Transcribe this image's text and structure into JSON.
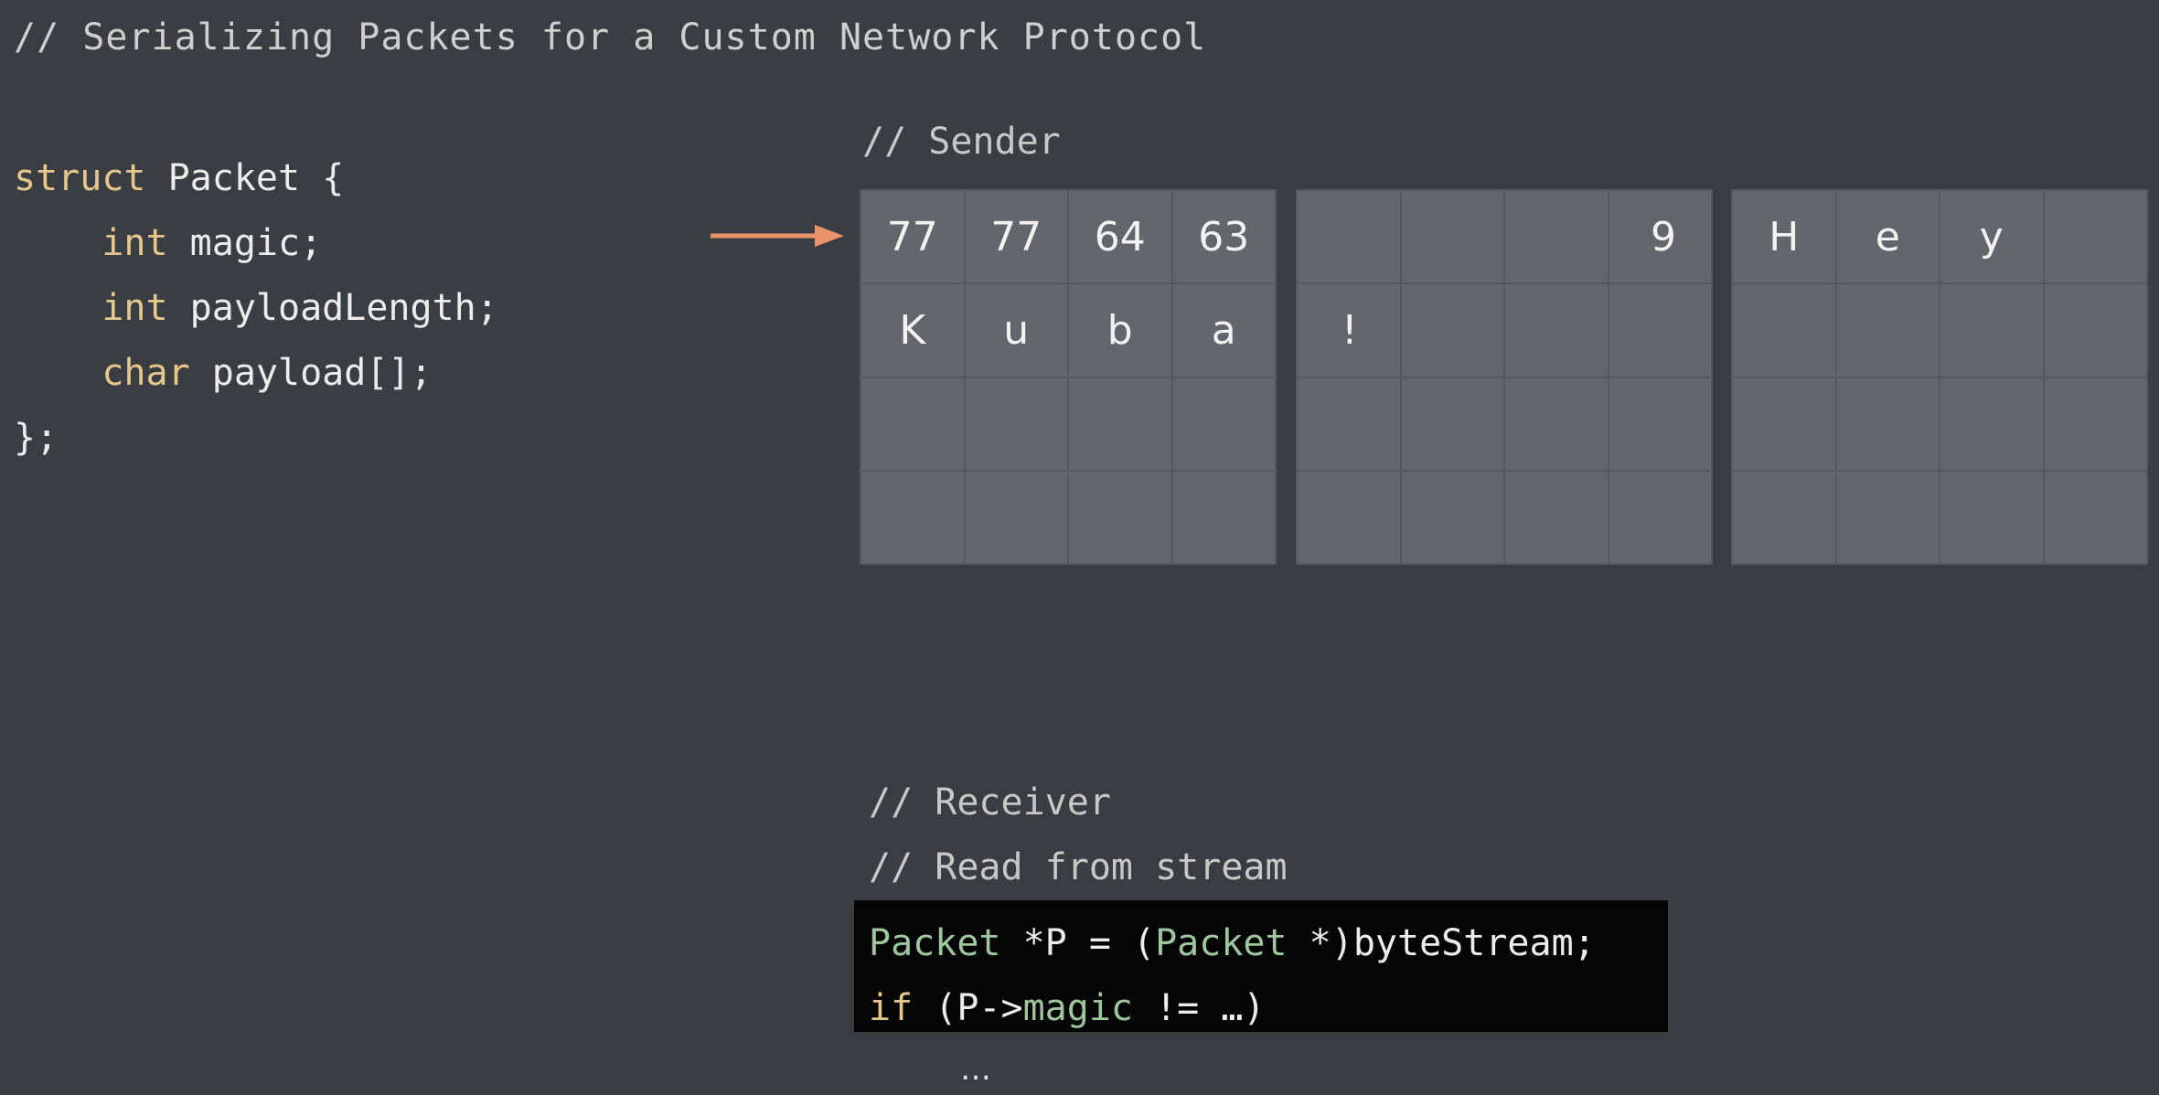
{
  "title": "// Serializing Packets for a Custom Network Protocol",
  "struct_code": {
    "line1_kw": "struct",
    "line1_rest": " Packet {",
    "line2_kw": "int",
    "line2_rest": " magic;",
    "line3_kw": "int",
    "line3_rest": " payloadLength;",
    "line4_kw": "char",
    "line4_rest": " payload[];",
    "line5": "};"
  },
  "sender": {
    "comment": "// Sender",
    "grids": [
      {
        "cells": [
          "77",
          "77",
          "64",
          "63",
          "K",
          "u",
          "b",
          "a",
          "",
          "",
          "",
          "",
          "",
          "",
          "",
          ""
        ]
      },
      {
        "cells": [
          "",
          "",
          "",
          "9",
          "!",
          "",
          "",
          "",
          "",
          "",
          "",
          "",
          "",
          "",
          "",
          ""
        ]
      },
      {
        "cells": [
          "H",
          "e",
          "y",
          "",
          "",
          "",
          "",
          "",
          "",
          "",
          "",
          "",
          "",
          "",
          "",
          ""
        ]
      }
    ]
  },
  "receiver": {
    "comment1": "// Receiver",
    "comment2": "// Read from stream",
    "code_line1": {
      "type1": "Packet",
      "mid1": " *P = (",
      "type2": "Packet",
      "mid2": " *)byteStream;"
    },
    "code_line2": {
      "kw": "if",
      "mid": " (P->",
      "field": "magic",
      "rest": " != …)"
    },
    "ellipsis": "…"
  },
  "colors": {
    "background": "#3a3d42",
    "arrow": "#e8936a",
    "keyword": "#e5c78e",
    "type": "#9fc79e",
    "cell": "#63666c"
  }
}
